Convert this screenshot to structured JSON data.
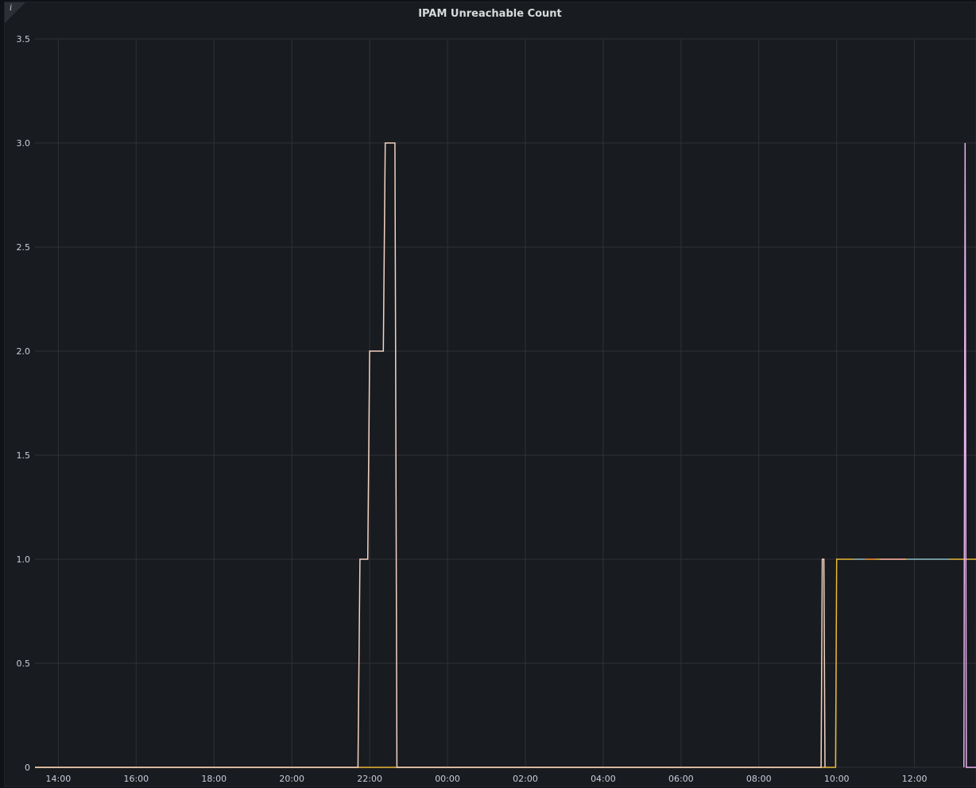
{
  "panel": {
    "title": "IPAM Unreachable Count",
    "info_icon": "info-icon"
  },
  "colors": {
    "background": "#181b1f",
    "grid": "#2f3137",
    "tick_text": "#ccccdc"
  },
  "chart_data": {
    "type": "line",
    "title": "IPAM Unreachable Count",
    "xlabel": "",
    "ylabel": "",
    "x_unit": "hour of day (continues past midnight: 24 = 00:00 next day)",
    "xlim": [
      13.4,
      37.6
    ],
    "ylim": [
      0,
      3.5
    ],
    "grid": true,
    "legend": "none",
    "x_ticks": [
      {
        "value": 14,
        "label": "14:00"
      },
      {
        "value": 16,
        "label": "16:00"
      },
      {
        "value": 18,
        "label": "18:00"
      },
      {
        "value": 20,
        "label": "20:00"
      },
      {
        "value": 22,
        "label": "22:00"
      },
      {
        "value": 24,
        "label": "00:00"
      },
      {
        "value": 26,
        "label": "02:00"
      },
      {
        "value": 28,
        "label": "04:00"
      },
      {
        "value": 30,
        "label": "06:00"
      },
      {
        "value": 32,
        "label": "08:00"
      },
      {
        "value": 34,
        "label": "10:00"
      },
      {
        "value": 36,
        "label": "12:00"
      }
    ],
    "y_ticks": [
      {
        "value": 0,
        "label": "0"
      },
      {
        "value": 0.5,
        "label": "0.5"
      },
      {
        "value": 1.0,
        "label": "1.0"
      },
      {
        "value": 1.5,
        "label": "1.5"
      },
      {
        "value": 2.0,
        "label": "2.0"
      },
      {
        "value": 2.5,
        "label": "2.5"
      },
      {
        "value": 3.0,
        "label": "3.0"
      },
      {
        "value": 3.5,
        "label": "3.5"
      }
    ],
    "series": [
      {
        "color": "#eab839",
        "x": [
          13.4,
          33.97,
          34.0,
          37.6
        ],
        "y": [
          0,
          0,
          1,
          1
        ]
      },
      {
        "color": "#f4d3c2",
        "x": [
          13.4,
          21.7,
          21.75,
          21.95,
          22.0,
          22.35,
          22.4,
          22.65,
          22.7,
          33.6,
          33.63,
          33.67,
          33.7
        ],
        "y": [
          0,
          0,
          1,
          1,
          2,
          2,
          3,
          3,
          0,
          0,
          1,
          1,
          0
        ]
      },
      {
        "color": "#6ea6c7",
        "x": [
          34.45,
          34.72
        ],
        "y": [
          1,
          1
        ]
      },
      {
        "color": "#e0752d",
        "x": [
          34.72,
          34.98
        ],
        "y": [
          1,
          1
        ]
      },
      {
        "color": "#ea9fa6",
        "x": [
          35.1,
          35.78
        ],
        "y": [
          1,
          1
        ]
      },
      {
        "color": "#6ea6c7",
        "x": [
          35.8,
          36.9
        ],
        "y": [
          1,
          1
        ]
      },
      {
        "color": "#e9b2ef",
        "x": [
          37.27,
          37.3,
          37.33,
          37.6
        ],
        "y": [
          0,
          3,
          0,
          0
        ]
      }
    ]
  }
}
